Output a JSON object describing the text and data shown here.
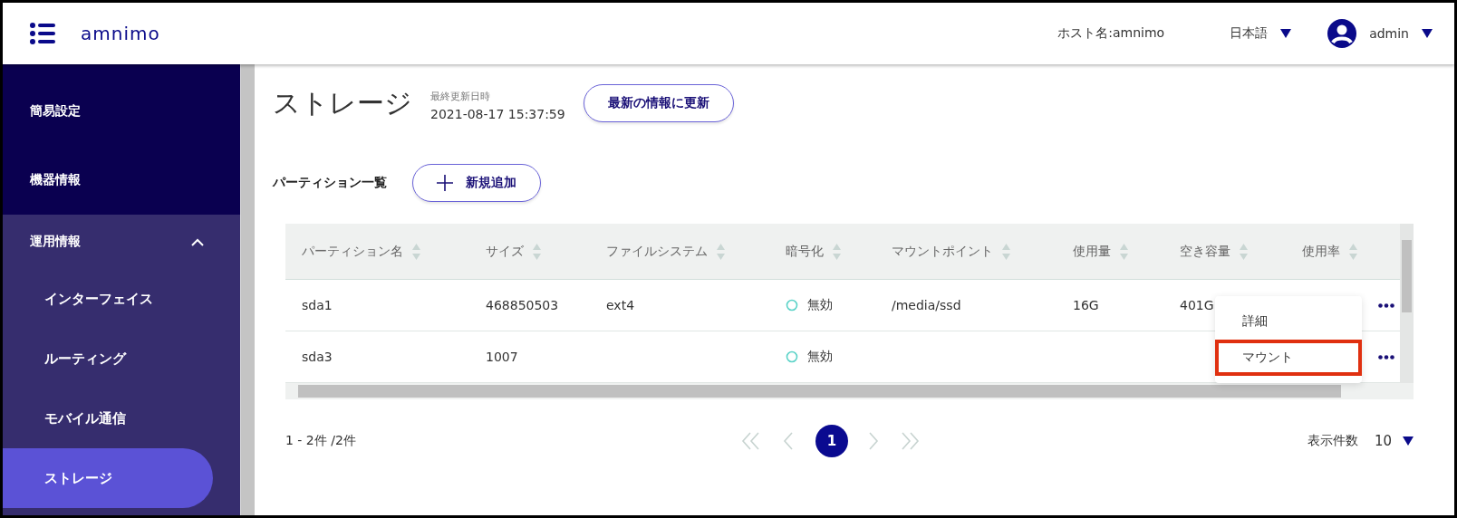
{
  "header": {
    "logo": "amnimo",
    "host": "ホスト名:amnimo",
    "language": "日本語",
    "user": "admin"
  },
  "sidebar": {
    "items": [
      {
        "label": "簡易設定",
        "selected": false
      },
      {
        "label": "機器情報",
        "selected": false
      },
      {
        "label": "運用情報",
        "selected": false,
        "expanded": true,
        "children": [
          {
            "label": "インターフェイス",
            "selected": false
          },
          {
            "label": "ルーティング",
            "selected": false
          },
          {
            "label": "モバイル通信",
            "selected": false
          },
          {
            "label": "ストレージ",
            "selected": true
          }
        ]
      }
    ]
  },
  "page": {
    "title": "ストレージ",
    "updated_label": "最終更新日時",
    "updated_at": "2021-08-17 15:37:59",
    "refresh_button": "最新の情報に更新"
  },
  "section": {
    "title": "パーティション一覧",
    "add_button": "新規追加"
  },
  "table": {
    "columns": [
      "パーティション名",
      "サイズ",
      "ファイルシステム",
      "暗号化",
      "マウントポイント",
      "使用量",
      "空き容量",
      "使用率"
    ],
    "rows": [
      {
        "cells": [
          "sda1",
          "468850503",
          "ext4",
          "無効",
          "/media/ssd",
          "16G",
          "401G",
          null
        ],
        "encrypted": false
      },
      {
        "cells": [
          "sda3",
          "1007",
          null,
          "無効",
          null,
          null,
          null,
          null
        ],
        "encrypted": false
      }
    ]
  },
  "row_menu": {
    "items": [
      {
        "label": "詳細",
        "highlighted": false
      },
      {
        "label": "マウント",
        "highlighted": true
      }
    ]
  },
  "pagination": {
    "summary": "1 - 2件 /2件",
    "pages": [
      {
        "label": "1",
        "selected": true
      }
    ],
    "page_size_label": "表示件数",
    "page_size": "10"
  }
}
